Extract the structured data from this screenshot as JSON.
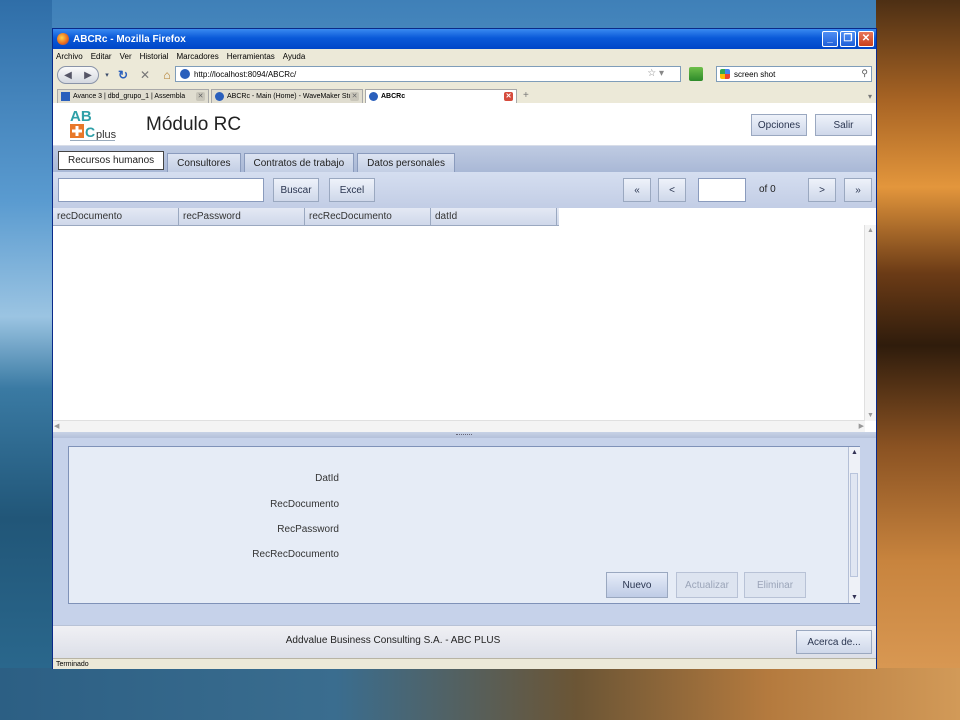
{
  "window": {
    "title": "ABCRc - Mozilla Firefox"
  },
  "menu": [
    "Archivo",
    "Editar",
    "Ver",
    "Historial",
    "Marcadores",
    "Herramientas",
    "Ayuda"
  ],
  "navigation": {
    "url": "http://localhost:8094/ABCRc/",
    "search_value": "screen shot"
  },
  "browser_tabs": [
    {
      "label": "Avance 3 | dbd_grupo_1 | Assembla",
      "active": false
    },
    {
      "label": "ABCRc - Main (Home) - WaveMaker Stu...",
      "active": false
    },
    {
      "label": "ABCRc",
      "active": true
    }
  ],
  "app": {
    "logo_top": "AB",
    "logo_bottom": "plus",
    "title": "Módulo RC",
    "options_label": "Opciones",
    "logout_label": "Salir"
  },
  "app_tabs": [
    "Recursos humanos",
    "Consultores",
    "Contratos de trabajo",
    "Datos personales"
  ],
  "toolbar": {
    "search_label": "Buscar",
    "excel_label": "Excel",
    "first": "«",
    "prev": "<",
    "next": ">",
    "last": "»",
    "page_of": "of 0"
  },
  "grid": {
    "columns": [
      "recDocumento",
      "recPassword",
      "recRecDocumento",
      "datId"
    ]
  },
  "detail": {
    "fields": [
      "DatId",
      "RecDocumento",
      "RecPassword",
      "RecRecDocumento"
    ],
    "new_label": "Nuevo",
    "update_label": "Actualizar",
    "delete_label": "Eliminar"
  },
  "footer": {
    "text": "Addvalue Business Consulting S.A. - ABC PLUS",
    "about_label": "Acerca de..."
  },
  "status": "Terminado",
  "colors": {
    "titlebar": "#0a59d8",
    "app_chrome": "#c2cde5",
    "logo_teal": "#2fa0a8",
    "logo_orange": "#e8782a"
  }
}
